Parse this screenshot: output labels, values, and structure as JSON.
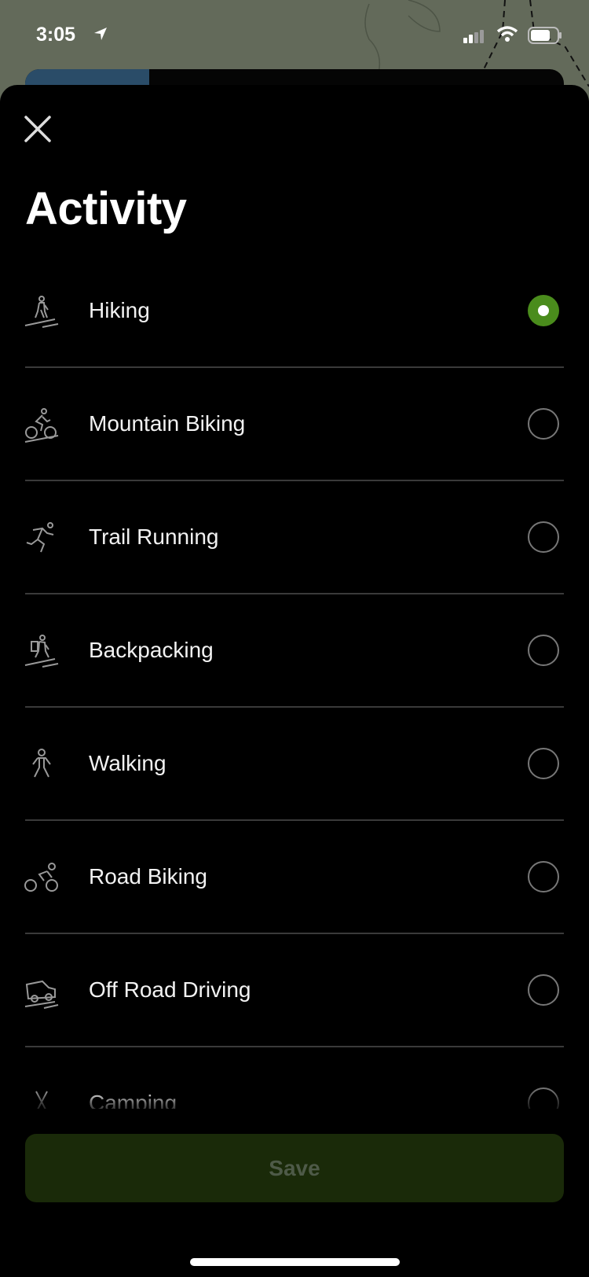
{
  "status_bar": {
    "time": "3:05",
    "icons": [
      "location-arrow-icon",
      "signal-icon",
      "wifi-icon",
      "battery-icon"
    ]
  },
  "sheet": {
    "close_icon": "close-icon",
    "title": "Activity",
    "items": [
      {
        "label": "Hiking",
        "icon": "hiking-icon",
        "selected": true
      },
      {
        "label": "Mountain Biking",
        "icon": "mountain-biking-icon",
        "selected": false
      },
      {
        "label": "Trail Running",
        "icon": "trail-running-icon",
        "selected": false
      },
      {
        "label": "Backpacking",
        "icon": "backpacking-icon",
        "selected": false
      },
      {
        "label": "Walking",
        "icon": "walking-icon",
        "selected": false
      },
      {
        "label": "Road Biking",
        "icon": "road-biking-icon",
        "selected": false
      },
      {
        "label": "Off Road Driving",
        "icon": "off-road-driving-icon",
        "selected": false
      },
      {
        "label": "Camping",
        "icon": "camping-icon",
        "selected": false
      }
    ],
    "save_label": "Save"
  },
  "colors": {
    "accent": "#4a8c1c",
    "save_bg": "#1a2a09",
    "save_text": "#4e5a48",
    "background": "#000000"
  }
}
